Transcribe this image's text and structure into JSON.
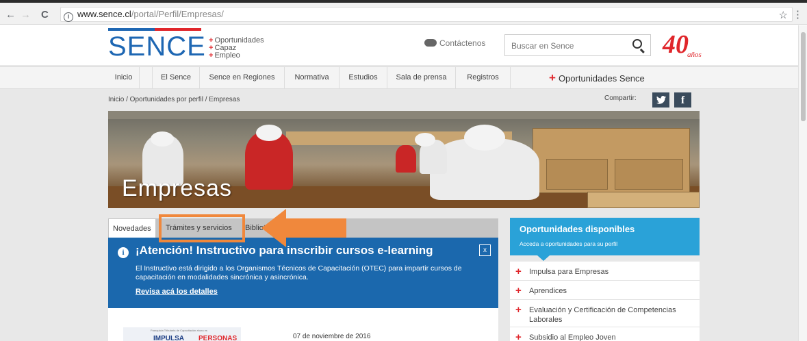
{
  "browser": {
    "back_icon": "←",
    "forward_icon": "→",
    "reload_icon": "C",
    "url_host": "www.sence.cl",
    "url_path": "/portal/Perfil/Empresas/",
    "star_icon": "☆",
    "menu_icon": "⋮"
  },
  "header": {
    "logo": "SENCE",
    "tagline": [
      "Oportunidades",
      "Capaz",
      "Empleo"
    ],
    "contact": "Contáctenos",
    "search_placeholder": "Buscar en Sence",
    "anniversary_number": "40",
    "anniversary_label": "años"
  },
  "menu": {
    "items": [
      "Inicio",
      "El Sence",
      "Sence en Regiones",
      "Normativa",
      "Estudios",
      "Sala de prensa",
      "Registros"
    ],
    "opportunities": "Oportunidades Sence"
  },
  "breadcrumb": "Inicio / Oportunidades por perfil / Empresas",
  "share": {
    "label": "Compartir:",
    "twitter": "🐦",
    "facebook": "f"
  },
  "hero": {
    "title": "Empresas"
  },
  "tabs": [
    "Novedades",
    "Trámites y servicios",
    "Bibliotecas"
  ],
  "notice": {
    "title": "¡Atención! Instructivo para inscribir cursos e-learning",
    "close": "x",
    "body": "El Instructivo está dirigido a los Organismos Técnicos de Capacitación (OTEC) para impartir cursos de capacitación en modalidades sincrónica y asincrónica.",
    "link": "Revisa acá los detalles"
  },
  "news": {
    "thumb_caption": "Franquicia Tributaria de Capacitación ahora es",
    "thumb_word1": "IMPULSA",
    "thumb_word2": "PERSONAS",
    "date": "07 de noviembre de 2016"
  },
  "right_panel": {
    "title": "Oportunidades disponibles",
    "subtitle": "Acceda a oportunidades para su perfil",
    "items": [
      "Impulsa para Empresas",
      "Aprendices",
      "Evaluación y Certificación de Competencias Laborales",
      "Subsidio al Empleo Joven"
    ]
  },
  "colors": {
    "brand_blue": "#1e67b3",
    "brand_red": "#e0262b",
    "notice_blue": "#1b68ad",
    "panel_cyan": "#2aa2d8",
    "highlight_orange": "#f0883c"
  }
}
